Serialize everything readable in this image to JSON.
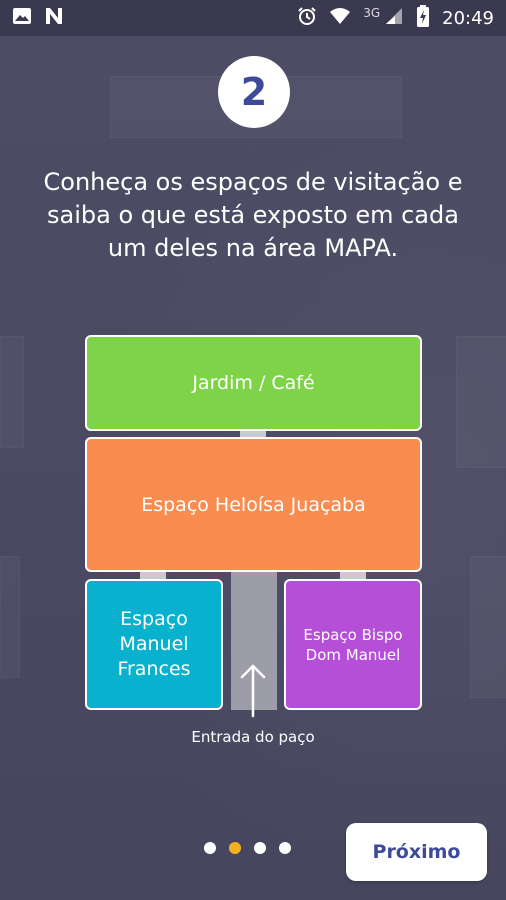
{
  "status_bar": {
    "time": "20:49",
    "network": "3G",
    "icons": [
      "image-icon",
      "n-icon",
      "alarm-icon",
      "wifi-icon",
      "signal-icon",
      "battery-charging-icon"
    ]
  },
  "onboarding": {
    "step_number": "2",
    "description": "Conheça os espaços de visitação e saiba o que está exposto em cada um deles na área MAPA.",
    "map": {
      "rooms": {
        "garden": "Jardim / Café",
        "heloisa": "Espaço Heloísa Juaçaba",
        "manuel": "Espaço Manuel Frances",
        "bispo": "Espaço Bispo Dom Manuel"
      },
      "entrance_label": "Entrada do paço"
    },
    "pagination": {
      "total": 4,
      "current": 2
    },
    "next_button_label": "Próximo"
  },
  "colors": {
    "background": "#4b4a63",
    "garden": "#7ed348",
    "heloisa": "#fb8c4f",
    "manuel": "#08b2cf",
    "bispo": "#b54fd8",
    "accent": "#3d4a9a",
    "active_dot": "#f2b21f"
  }
}
